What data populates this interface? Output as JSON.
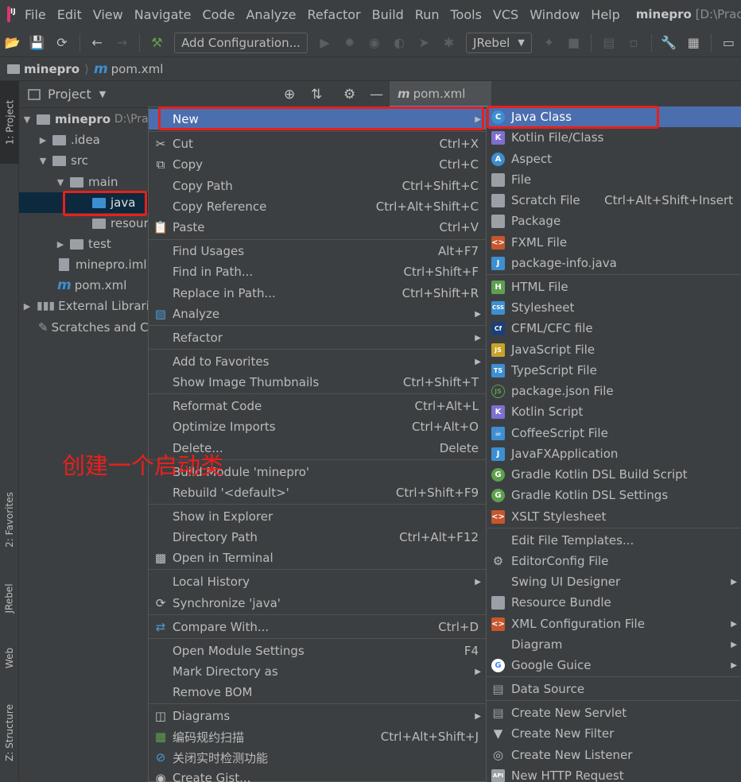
{
  "menubar": {
    "items": [
      "File",
      "Edit",
      "View",
      "Navigate",
      "Code",
      "Analyze",
      "Refactor",
      "Build",
      "Run",
      "Tools",
      "VCS",
      "Window",
      "Help"
    ],
    "project": "minepro",
    "path": "[D:\\Practic"
  },
  "toolbar": {
    "add_config": "Add Configuration...",
    "jrebel": "JRebel"
  },
  "breadcrumb": {
    "project": "minepro",
    "file": "pom.xml"
  },
  "leftstrip": {
    "project": "1: Project",
    "favorites": "2: Favorites",
    "jrebel": "JRebel",
    "web": "Web",
    "structure": "Z: Structure"
  },
  "project_panel": {
    "title": "Project",
    "tree": [
      {
        "label": "minepro",
        "hint": "D:\\Pra"
      },
      {
        "label": ".idea"
      },
      {
        "label": "src"
      },
      {
        "label": "main"
      },
      {
        "label": "java"
      },
      {
        "label": "resour"
      },
      {
        "label": "test"
      },
      {
        "label": "minepro.iml"
      },
      {
        "label": "pom.xml"
      },
      {
        "label": "External Libraries"
      },
      {
        "label": "Scratches and C"
      }
    ]
  },
  "editor_tab": {
    "label": "pom.xml"
  },
  "context_menu": {
    "items": [
      {
        "label": "New",
        "shortcut": ""
      },
      {
        "label": "Cut",
        "shortcut": "Ctrl+X"
      },
      {
        "label": "Copy",
        "shortcut": "Ctrl+C"
      },
      {
        "label": "Copy Path",
        "shortcut": "Ctrl+Shift+C"
      },
      {
        "label": "Copy Reference",
        "shortcut": "Ctrl+Alt+Shift+C"
      },
      {
        "label": "Paste",
        "shortcut": "Ctrl+V"
      },
      {
        "label": "Find Usages",
        "shortcut": "Alt+F7"
      },
      {
        "label": "Find in Path...",
        "shortcut": "Ctrl+Shift+F"
      },
      {
        "label": "Replace in Path...",
        "shortcut": "Ctrl+Shift+R"
      },
      {
        "label": "Analyze",
        "shortcut": ""
      },
      {
        "label": "Refactor",
        "shortcut": ""
      },
      {
        "label": "Add to Favorites",
        "shortcut": ""
      },
      {
        "label": "Show Image Thumbnails",
        "shortcut": "Ctrl+Shift+T"
      },
      {
        "label": "Reformat Code",
        "shortcut": "Ctrl+Alt+L"
      },
      {
        "label": "Optimize Imports",
        "shortcut": "Ctrl+Alt+O"
      },
      {
        "label": "Delete...",
        "shortcut": "Delete"
      },
      {
        "label": "Build Module 'minepro'",
        "shortcut": ""
      },
      {
        "label": "Rebuild '<default>'",
        "shortcut": "Ctrl+Shift+F9"
      },
      {
        "label": "Show in Explorer",
        "shortcut": ""
      },
      {
        "label": "Directory Path",
        "shortcut": "Ctrl+Alt+F12"
      },
      {
        "label": "Open in Terminal",
        "shortcut": ""
      },
      {
        "label": "Local History",
        "shortcut": ""
      },
      {
        "label": "Synchronize 'java'",
        "shortcut": ""
      },
      {
        "label": "Compare With...",
        "shortcut": "Ctrl+D"
      },
      {
        "label": "Open Module Settings",
        "shortcut": "F4"
      },
      {
        "label": "Mark Directory as",
        "shortcut": ""
      },
      {
        "label": "Remove BOM",
        "shortcut": ""
      },
      {
        "label": "Diagrams",
        "shortcut": ""
      },
      {
        "label": "编码规约扫描",
        "shortcut": "Ctrl+Alt+Shift+J"
      },
      {
        "label": "关闭实时检测功能",
        "shortcut": ""
      },
      {
        "label": "Create Gist...",
        "shortcut": ""
      }
    ]
  },
  "new_submenu": {
    "items": [
      {
        "label": "Java Class",
        "shortcut": ""
      },
      {
        "label": "Kotlin File/Class",
        "shortcut": ""
      },
      {
        "label": "Aspect",
        "shortcut": ""
      },
      {
        "label": "File",
        "shortcut": ""
      },
      {
        "label": "Scratch File",
        "shortcut": "Ctrl+Alt+Shift+Insert"
      },
      {
        "label": "Package",
        "shortcut": ""
      },
      {
        "label": "FXML File",
        "shortcut": ""
      },
      {
        "label": "package-info.java",
        "shortcut": ""
      },
      {
        "label": "HTML File",
        "shortcut": ""
      },
      {
        "label": "Stylesheet",
        "shortcut": ""
      },
      {
        "label": "CFML/CFC file",
        "shortcut": ""
      },
      {
        "label": "JavaScript File",
        "shortcut": ""
      },
      {
        "label": "TypeScript File",
        "shortcut": ""
      },
      {
        "label": "package.json File",
        "shortcut": ""
      },
      {
        "label": "Kotlin Script",
        "shortcut": ""
      },
      {
        "label": "CoffeeScript File",
        "shortcut": ""
      },
      {
        "label": "JavaFXApplication",
        "shortcut": ""
      },
      {
        "label": "Gradle Kotlin DSL Build Script",
        "shortcut": ""
      },
      {
        "label": "Gradle Kotlin DSL Settings",
        "shortcut": ""
      },
      {
        "label": "XSLT Stylesheet",
        "shortcut": ""
      },
      {
        "label": "Edit File Templates...",
        "shortcut": ""
      },
      {
        "label": "EditorConfig File",
        "shortcut": ""
      },
      {
        "label": "Swing UI Designer",
        "shortcut": ""
      },
      {
        "label": "Resource Bundle",
        "shortcut": ""
      },
      {
        "label": "XML Configuration File",
        "shortcut": ""
      },
      {
        "label": "Diagram",
        "shortcut": ""
      },
      {
        "label": "Google Guice",
        "shortcut": ""
      },
      {
        "label": "Data Source",
        "shortcut": ""
      },
      {
        "label": "Create New Servlet",
        "shortcut": ""
      },
      {
        "label": "Create New Filter",
        "shortcut": ""
      },
      {
        "label": "Create New Listener",
        "shortcut": ""
      },
      {
        "label": "New HTTP Request",
        "shortcut": ""
      }
    ]
  },
  "annotation": "创建一个启动类",
  "colors": {
    "highlight": "#4b6eaf",
    "annotation_red": "#e8201b",
    "selection": "#0d293e"
  }
}
